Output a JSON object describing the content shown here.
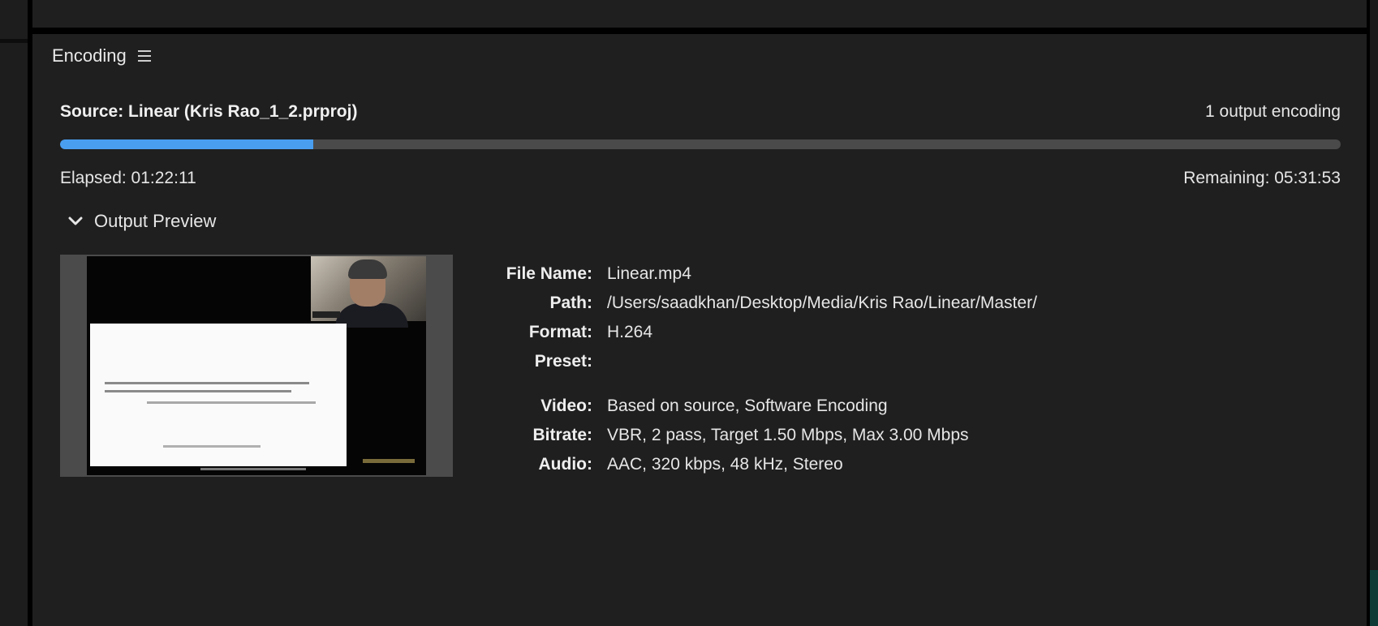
{
  "panel": {
    "title": "Encoding",
    "menu_icon": "hamburger-menu-icon"
  },
  "encoding": {
    "source": "Source: Linear (Kris Rao_1_2.prproj)",
    "output_count": "1 output encoding",
    "progress_fraction": 0.198,
    "elapsed": "Elapsed: 01:22:11",
    "remaining": "Remaining: 05:31:53",
    "accent_color": "#4a9ef0"
  },
  "preview": {
    "toggle_icon": "chevron-down-icon",
    "title": "Output Preview"
  },
  "details": {
    "file_name": {
      "label": "File Name:",
      "value": "Linear.mp4"
    },
    "path": {
      "label": "Path:",
      "value": "/Users/saadkhan/Desktop/Media/Kris Rao/Linear/Master/"
    },
    "format": {
      "label": "Format:",
      "value": "H.264"
    },
    "preset": {
      "label": "Preset:",
      "value": ""
    },
    "video": {
      "label": "Video:",
      "value": "Based on source, Software Encoding"
    },
    "bitrate": {
      "label": "Bitrate:",
      "value": "VBR, 2 pass, Target 1.50 Mbps, Max 3.00 Mbps"
    },
    "audio": {
      "label": "Audio:",
      "value": "AAC, 320 kbps, 48 kHz, Stereo"
    }
  }
}
